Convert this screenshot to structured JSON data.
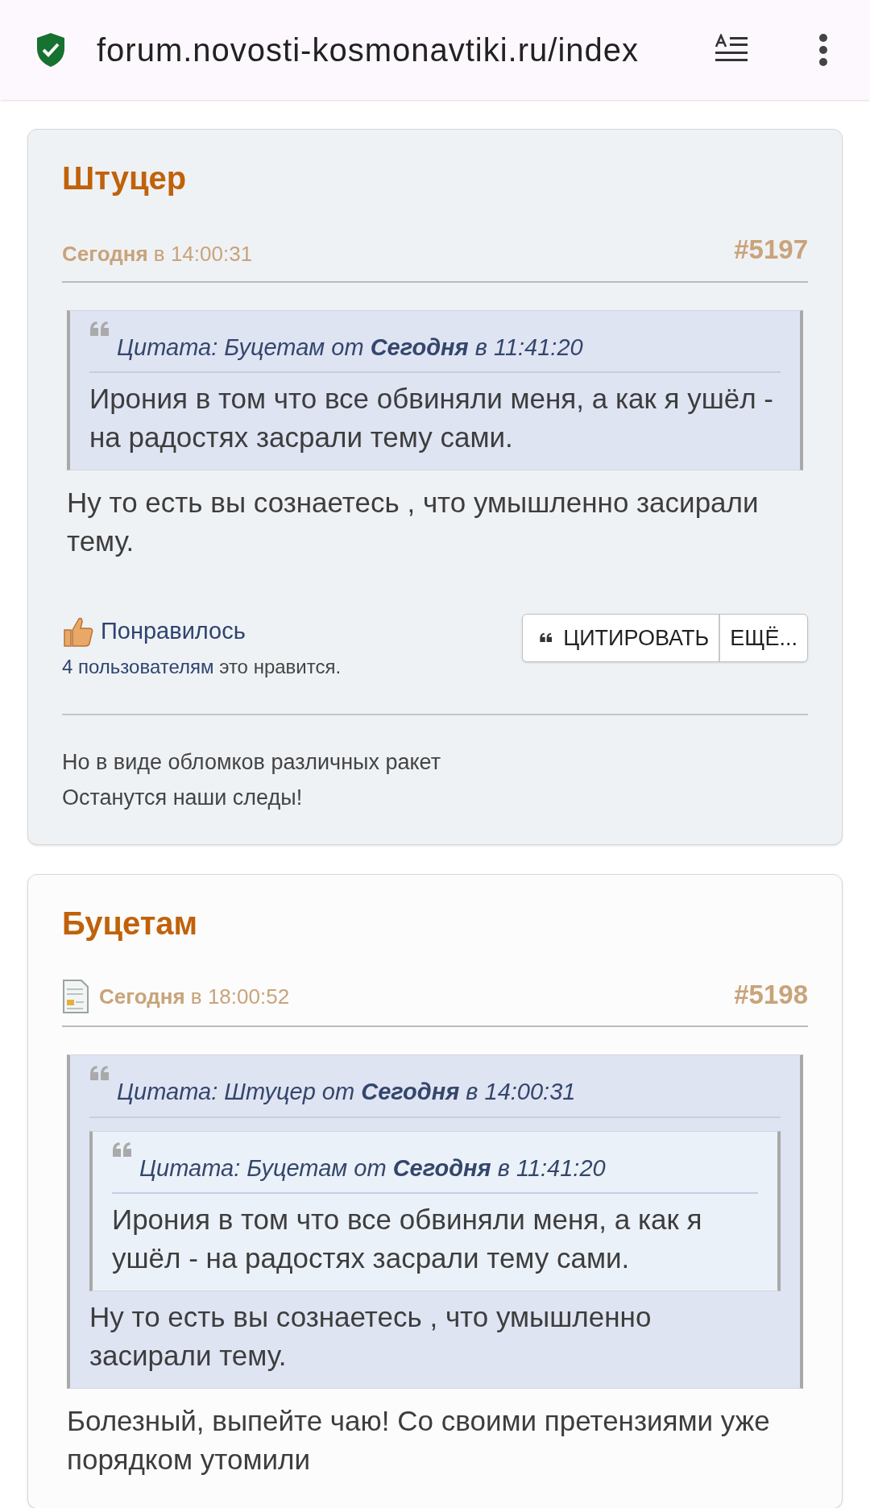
{
  "browser": {
    "url": "forum.novosti-kosmonavtiki.ru/index"
  },
  "posts": [
    {
      "author": "Штуцер",
      "date": "**Сегодня** в 14:00:31",
      "number": "#5197",
      "has_doc_icon": false,
      "quote": {
        "header": "Цитата: Буцетам от **Сегодня** в 11:41:20",
        "text": "Ирония в том что все обвиняли меня, а как я ушёл - на радостях засрали тему сами."
      },
      "text": "Ну то есть вы сознаетесь , что умышленно засирали тему.",
      "like": {
        "label": "Понравилось",
        "count_link": "4 пользователям",
        "count_rest": "это нравится."
      },
      "buttons": [
        "ЦИТИРОВАТЬ",
        "ЕЩЁ..."
      ],
      "signature": [
        "Но в виде обломков различных ракет",
        "Останутся наши следы!"
      ]
    },
    {
      "author": "Буцетам",
      "date": "**Сегодня** в 18:00:52",
      "number": "#5198",
      "has_doc_icon": true,
      "quote": {
        "header": "Цитата: Штуцер от **Сегодня** в 14:00:31",
        "quote": {
          "header": "Цитата: Буцетам от **Сегодня** в 11:41:20",
          "text": "Ирония в том что все обвиняли меня, а как я ушёл - на радостях засрали тему сами."
        },
        "text": "Ну то есть вы сознаетесь , что умышленно засирали тему."
      },
      "text": "Болезный, выпейте чаю! Со своими претензиями уже порядком утомили"
    }
  ]
}
